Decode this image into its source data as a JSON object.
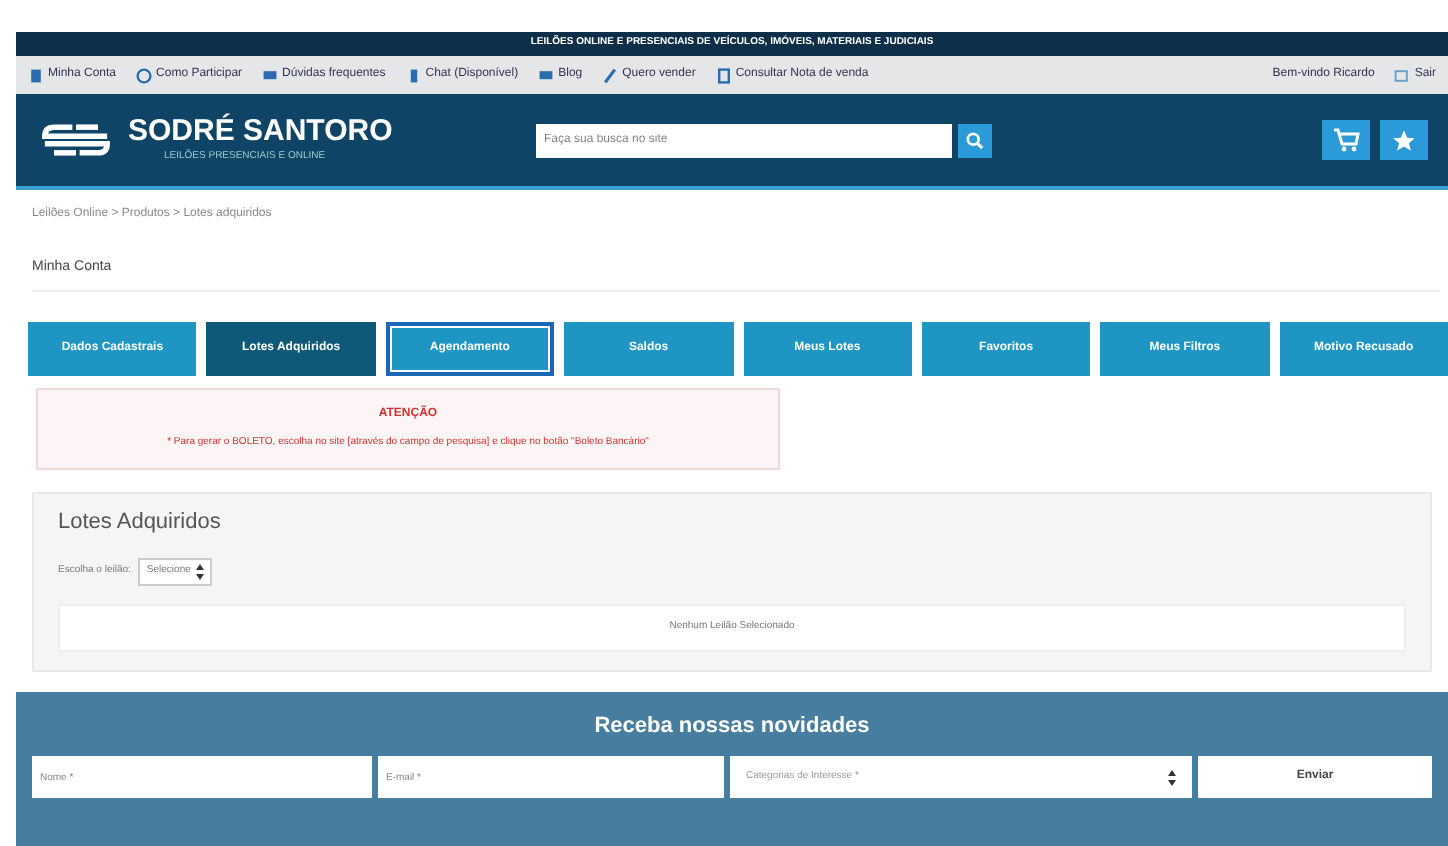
{
  "top_banner": "LEILÕES ONLINE E PRESENCIAIS DE VEÍCULOS, IMÓVEIS, MATERIAIS E JUDICIAIS",
  "top_links": [
    {
      "label": "Minha Conta"
    },
    {
      "label": "Como Participar"
    },
    {
      "label": "Dúvidas frequentes"
    },
    {
      "label": "Chat (Disponível)"
    },
    {
      "label": "Blog"
    },
    {
      "label": "Quero vender"
    },
    {
      "label": "Consultar Nota de venda"
    }
  ],
  "user_links": [
    {
      "label": "Bem-vindo Ricardo"
    },
    {
      "label": "Sair"
    }
  ],
  "logo": {
    "name": "SODRÉ SANTORO",
    "tagline": "LEILÕES PRESENCIAIS E ONLINE"
  },
  "search": {
    "placeholder": "Faça sua busca no site"
  },
  "breadcrumb": "Leilões Online > Produtos > Lotes adquiridos",
  "page_title": "Minha Conta",
  "tabs": [
    {
      "label": "Dados Cadastrais",
      "selected": false,
      "focused": false
    },
    {
      "label": "Lotes Adquiridos",
      "selected": true,
      "focused": false
    },
    {
      "label": "Agendamento",
      "selected": false,
      "focused": true
    },
    {
      "label": "Saldos",
      "selected": false,
      "focused": false
    },
    {
      "label": "Meus Lotes",
      "selected": false,
      "focused": false
    },
    {
      "label": "Favoritos",
      "selected": false,
      "focused": false
    },
    {
      "label": "Meus Filtros",
      "selected": false,
      "focused": false
    },
    {
      "label": "Motivo Recusado",
      "selected": false,
      "focused": false
    }
  ],
  "alert": {
    "title": "ATENÇÃO",
    "message": "* Para gerar o BOLETO, escolha no site [através do campo de pesquisa] e clique no botão \"Boleto Bancário\""
  },
  "panel": {
    "title": "Lotes Adquiridos",
    "select_label": "Escolha o leilão:",
    "select_value": "Selecione",
    "empty_message": "Nenhum Leilão Selecionado"
  },
  "newsletter": {
    "title": "Receba nossas novidades",
    "name_placeholder": "Nome *",
    "email_placeholder": "E-mail *",
    "category_placeholder": "Categorias de Interesse *",
    "button": "Enviar"
  }
}
